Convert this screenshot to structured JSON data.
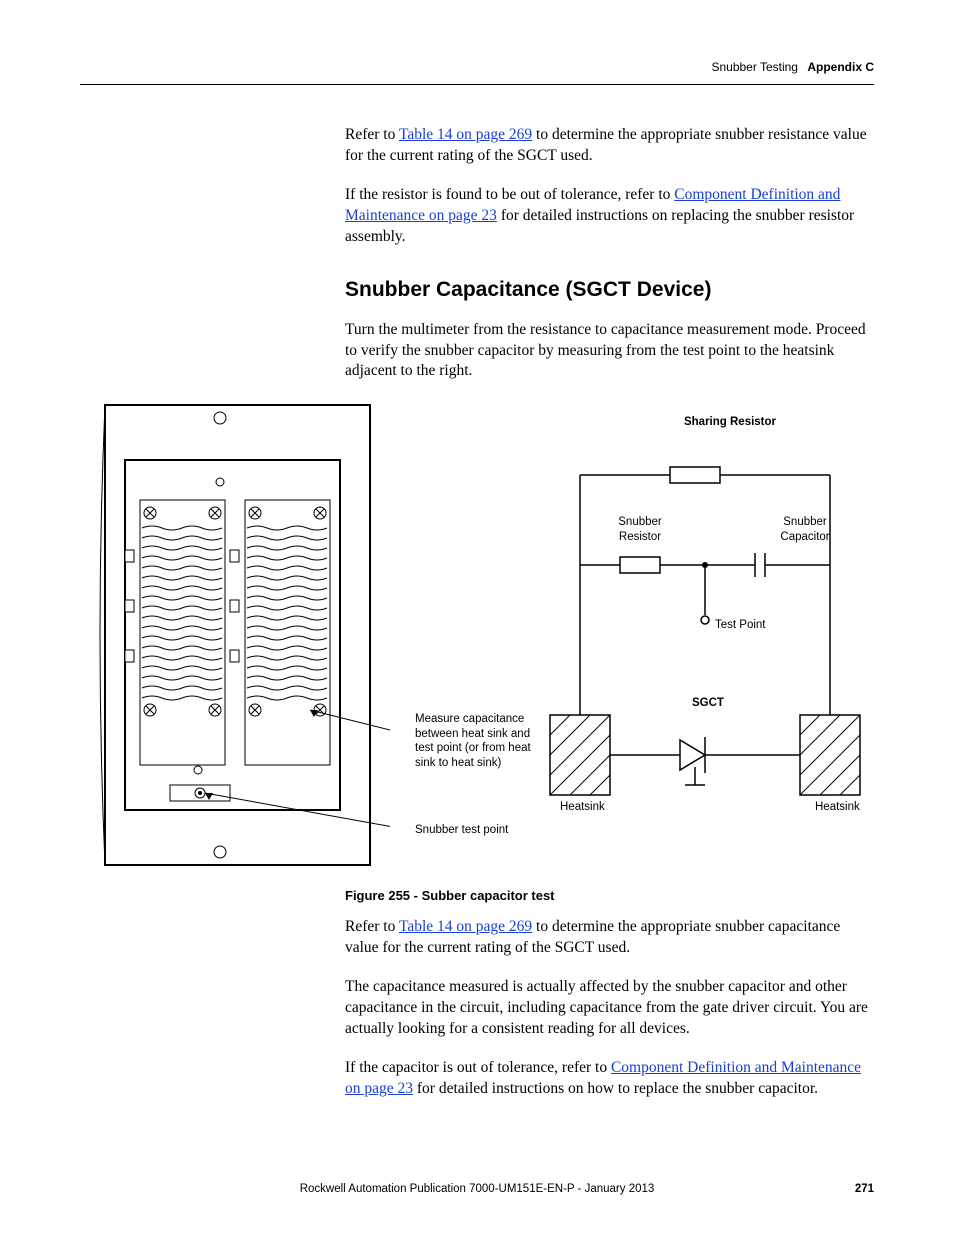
{
  "header": {
    "section": "Snubber Testing",
    "appendix": "Appendix C"
  },
  "para1a": "Refer to ",
  "link_table14": "Table 14 on page 269",
  "para1b": " to determine the appropriate snubber resistance value for the current rating of the SGCT used.",
  "para2a": "If the resistor is found to be out of tolerance, refer to ",
  "link_compdef": "Component Definition and Maintenance on page 23",
  "para2b": " for detailed instructions on replacing the snubber resistor assembly.",
  "heading": "Snubber Capacitance (SGCT Device)",
  "para3": "Turn the multimeter from the resistance to capacitance measurement mode. Proceed to verify the snubber capacitor by measuring from the test point to the heatsink adjacent to the right.",
  "figure": {
    "callout_measure": "Measure capacitance between heat sink and test point (or from heat sink to heat sink)",
    "callout_testpoint": "Snubber test point",
    "label_sharing_resistor": "Sharing Resistor",
    "label_snubber_resistor": "Snubber Resistor",
    "label_snubber_capacitor": "Snubber Capacitor",
    "label_test_point": "Test Point",
    "label_sgct": "SGCT",
    "label_heatsink_left": "Heatsink",
    "label_heatsink_right": "Heatsink",
    "caption": "Figure 255 - Subber capacitor test"
  },
  "para4a": "Refer to ",
  "para4b": " to determine the appropriate snubber capacitance value for the current rating of the SGCT used.",
  "para5": "The capacitance measured is actually affected by the snubber capacitor and other capacitance in the circuit, including capacitance from the gate driver circuit. You are actually looking for a consistent reading for all devices.",
  "para6a": "If the capacitor is out of tolerance, refer to ",
  "para6b": " for detailed instructions on how to replace the snubber capacitor.",
  "footer": {
    "publication": "Rockwell Automation Publication 7000-UM151E-EN-P - January 2013",
    "page": "271"
  }
}
